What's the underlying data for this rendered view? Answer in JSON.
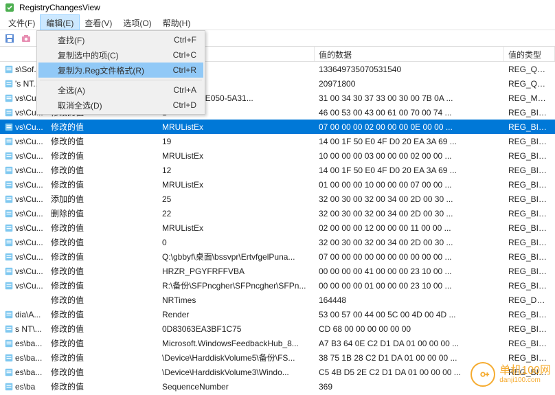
{
  "app": {
    "title": "RegistryChangesView"
  },
  "menubar": {
    "file": "文件(F)",
    "edit": "编辑(E)",
    "view": "查看(V)",
    "options": "选项(O)",
    "help": "帮助(H)"
  },
  "edit_menu": {
    "find": {
      "label": "查找(F)",
      "shortcut": "Ctrl+F"
    },
    "copy_selected": {
      "label": "复制选中的项(C)",
      "shortcut": "Ctrl+C"
    },
    "copy_as_reg": {
      "label": "复制为.Reg文件格式(R)",
      "shortcut": "Ctrl+R"
    },
    "select_all": {
      "label": "全选(A)",
      "shortcut": "Ctrl+A"
    },
    "deselect_all": {
      "label": "取消全选(D)",
      "shortcut": "Ctrl+D"
    }
  },
  "headers": {
    "path": "",
    "change": "",
    "name": "",
    "data": "值的数据",
    "type": "值的类型"
  },
  "rows": [
    {
      "path": "s\\Sof...",
      "change": "",
      "name": "",
      "data": "133649735070531540",
      "type": "REG_QWORD"
    },
    {
      "path": "'s NT...",
      "change": "",
      "name": "",
      "data": "20971800",
      "type": "REG_QWORD"
    },
    {
      "path": "vs\\Cu...",
      "change": "",
      "name": "BAA-8C7C-E050-5A31...",
      "data": "31 00 34 30 37 33 00 30 00 7B 0A ...",
      "type": "REG_MULTI_SZ"
    },
    {
      "path": "vs\\Cu...",
      "change": "修改的值",
      "name": "1",
      "data": "46 00 53 00 43 00 61 00 70 00 74 ...",
      "type": "REG_BINARY"
    },
    {
      "path": "vs\\Cu...",
      "change": "修改的值",
      "name": "MRUListEx",
      "data": "07 00 00 00 02 00 00 00 0E 00 00 ...",
      "type": "REG_BINARY",
      "selected": true
    },
    {
      "path": "vs\\Cu...",
      "change": "修改的值",
      "name": "19",
      "data": "14 00 1F 50 E0 4F D0 20 EA 3A 69 ...",
      "type": "REG_BINARY"
    },
    {
      "path": "vs\\Cu...",
      "change": "修改的值",
      "name": "MRUListEx",
      "data": "10 00 00 00 03 00 00 00 02 00 00 ...",
      "type": "REG_BINARY"
    },
    {
      "path": "vs\\Cu...",
      "change": "修改的值",
      "name": "12",
      "data": "14 00 1F 50 E0 4F D0 20 EA 3A 69 ...",
      "type": "REG_BINARY"
    },
    {
      "path": "vs\\Cu...",
      "change": "修改的值",
      "name": "MRUListEx",
      "data": "01 00 00 00 10 00 00 00 07 00 00 ...",
      "type": "REG_BINARY"
    },
    {
      "path": "vs\\Cu...",
      "change": "添加的值",
      "name": "25",
      "data": "32 00 30 00 32 00 34 00 2D 00 30 ...",
      "type": "REG_BINARY"
    },
    {
      "path": "vs\\Cu...",
      "change": "删除的值",
      "name": "22",
      "data": "32 00 30 00 32 00 34 00 2D 00 30 ...",
      "type": "REG_BINARY"
    },
    {
      "path": "vs\\Cu...",
      "change": "修改的值",
      "name": "MRUListEx",
      "data": "02 00 00 00 12 00 00 00 11 00 00 ...",
      "type": "REG_BINARY"
    },
    {
      "path": "vs\\Cu...",
      "change": "修改的值",
      "name": "0",
      "data": "32 00 30 00 32 00 34 00 2D 00 30 ...",
      "type": "REG_BINARY"
    },
    {
      "path": "vs\\Cu...",
      "change": "修改的值",
      "name": "Q:\\gbbyf\\桌面\\bssvpr\\ErtvfgelPuna...",
      "data": "07 00 00 00 00 00 00 00 00 00 00 ...",
      "type": "REG_BINARY"
    },
    {
      "path": "vs\\Cu...",
      "change": "修改的值",
      "name": "HRZR_PGYFRFFVBA",
      "data": "00 00 00 00 41 00 00 00 23 10 00 ...",
      "type": "REG_BINARY"
    },
    {
      "path": "vs\\Cu...",
      "change": "修改的值",
      "name": "R:\\备份\\SFPncgher\\SFPncgher\\SFPn...",
      "data": "00 00 00 00 01 00 00 00 23 10 00 ...",
      "type": "REG_BINARY"
    },
    {
      "path": "",
      "change": "修改的值",
      "name": "NRTimes",
      "data": "164448",
      "type": "REG_DWORD"
    },
    {
      "path": "dia\\A...",
      "change": "修改的值",
      "name": "Render",
      "data": "53 00 57 00 44 00 5C 00 4D 00 4D ...",
      "type": "REG_BINARY"
    },
    {
      "path": "s NT\\...",
      "change": "修改的值",
      "name": "0D83063EA3BF1C75",
      "data": "CD 68 00 00 00 00 00 00",
      "type": "REG_BINARY"
    },
    {
      "path": "es\\ba...",
      "change": "修改的值",
      "name": "Microsoft.WindowsFeedbackHub_8...",
      "data": "A7 B3 64 0E C2 D1 DA 01 00 00 00 ...",
      "type": "REG_BINARY"
    },
    {
      "path": "es\\ba...",
      "change": "修改的值",
      "name": "\\Device\\HarddiskVolume5\\备份\\FS...",
      "data": "38 75 1B 28 C2 D1 DA 01 00 00 00 ...",
      "type": "REG_BINARY"
    },
    {
      "path": "es\\ba...",
      "change": "修改的值",
      "name": "\\Device\\HarddiskVolume3\\Windo...",
      "data": "C5 4B D5 2E C2 D1 DA 01 00 00 00 ...",
      "type": "REG_BINARY"
    },
    {
      "path": "es\\ba",
      "change": "修改的值",
      "name": "SequenceNumber",
      "data": "369",
      "type": ""
    }
  ],
  "watermark": {
    "line1": "单机100网",
    "line2": "danji100.com"
  }
}
